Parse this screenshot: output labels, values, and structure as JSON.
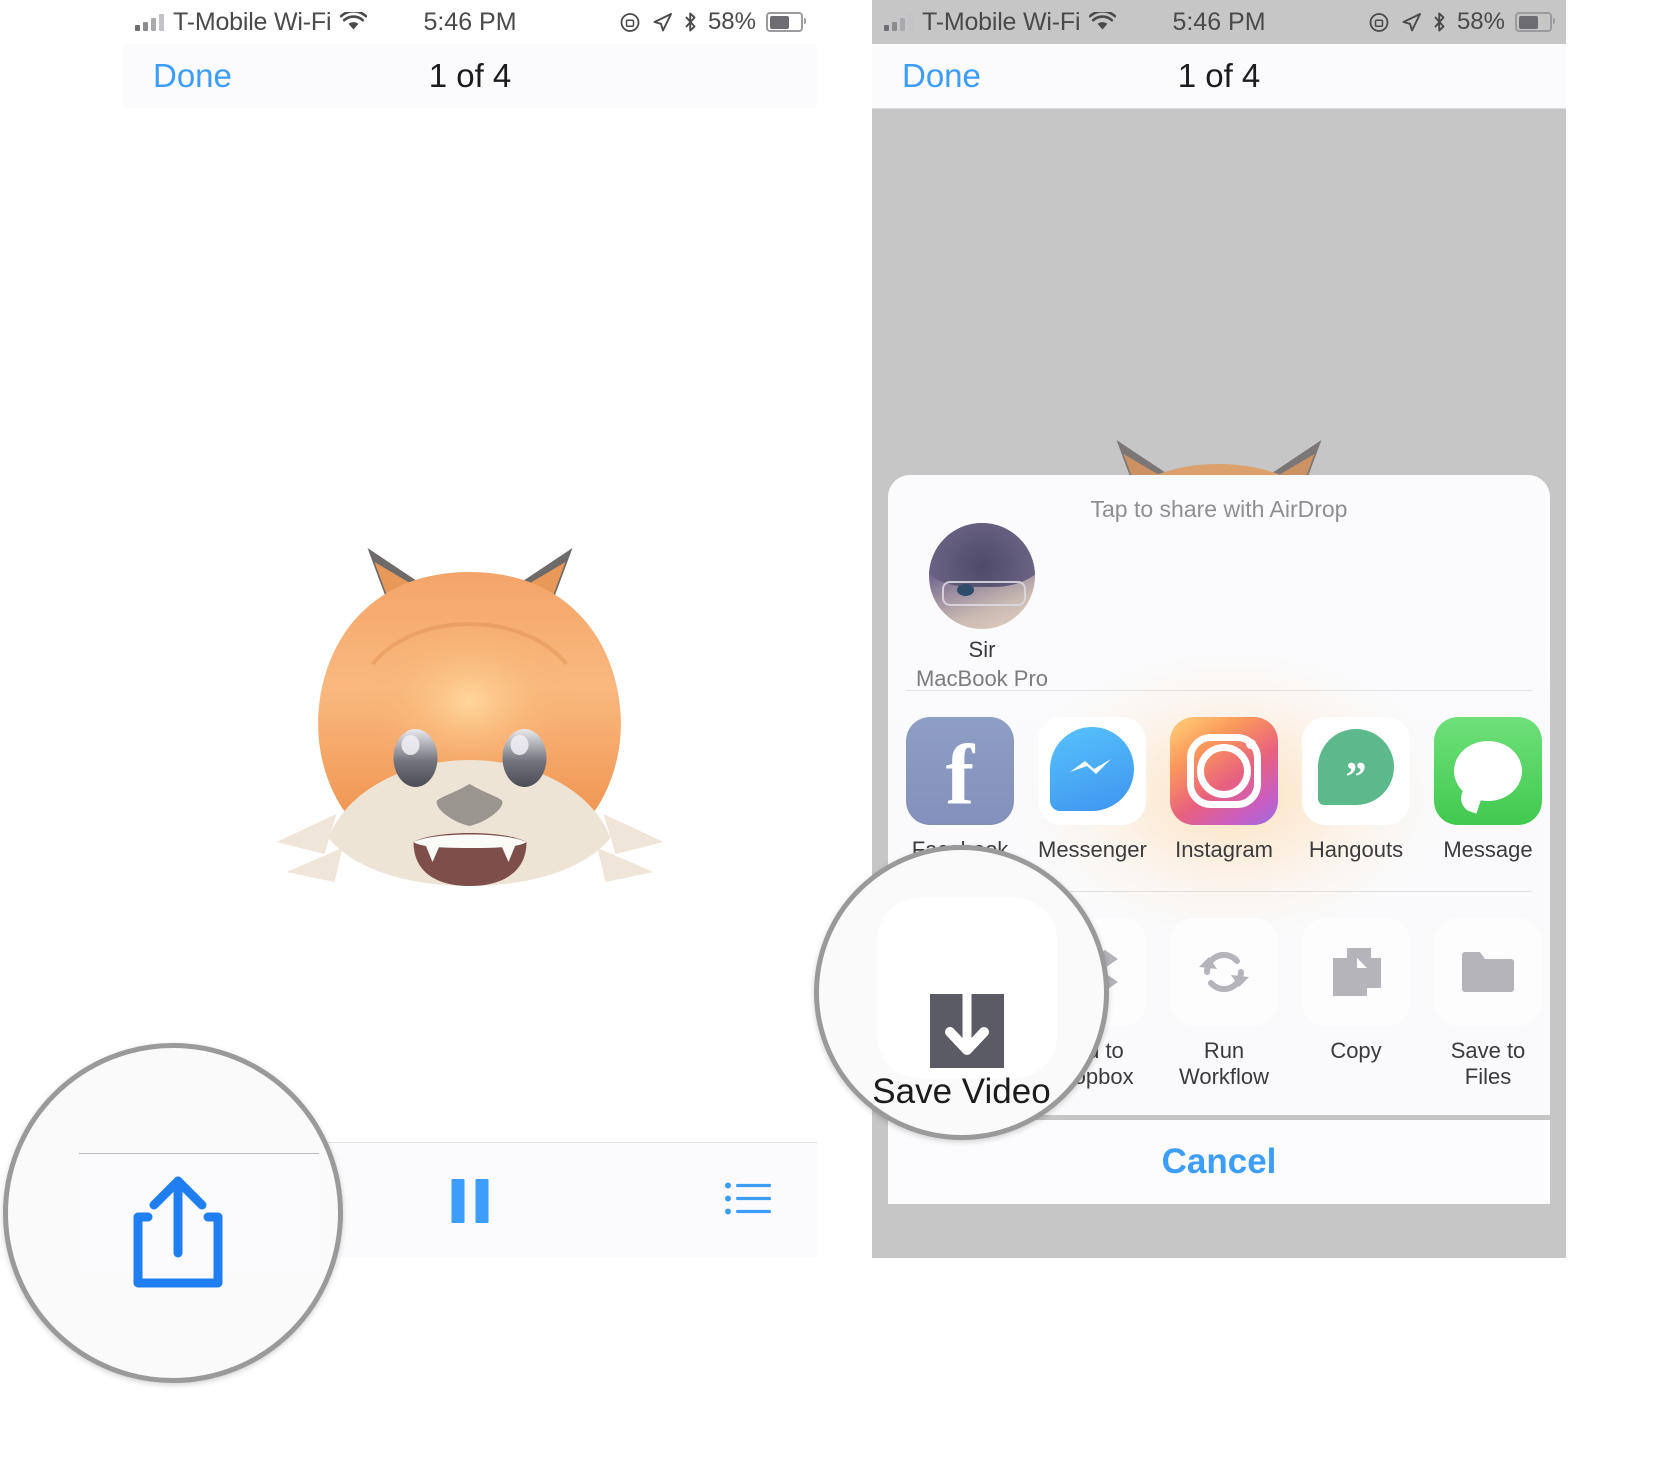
{
  "statusbar": {
    "carrier": "T-Mobile Wi-Fi",
    "time": "5:46 PM",
    "battery_percent": "58%",
    "icons": [
      "signal-bars-icon",
      "wifi-icon",
      "rotation-lock-icon",
      "location-arrow-icon",
      "bluetooth-icon",
      "battery-icon"
    ]
  },
  "navbar": {
    "done_label": "Done",
    "title": "1 of 4"
  },
  "left_screen": {
    "media": "animoji-fox-video",
    "toolbar": {
      "share_label": "share-icon",
      "playback_label": "pause-icon",
      "list_label": "list-icon"
    }
  },
  "share_sheet": {
    "airdrop_hint": "Tap to share with AirDrop",
    "airdrop_contacts": [
      {
        "name": "Sir",
        "device": "MacBook Pro"
      }
    ],
    "apps": [
      {
        "label": "Facebook",
        "icon": "facebook-icon"
      },
      {
        "label": "Messenger",
        "icon": "messenger-icon"
      },
      {
        "label": "Instagram",
        "icon": "instagram-icon"
      },
      {
        "label": "Hangouts",
        "icon": "hangouts-icon"
      },
      {
        "label": "Message",
        "icon": "message-icon"
      }
    ],
    "actions": [
      {
        "label": "Save Video",
        "icon": "save-video-icon"
      },
      {
        "label": "Add to Dropbox",
        "icon": "dropbox-icon"
      },
      {
        "label": "Run Workflow",
        "icon": "run-workflow-icon"
      },
      {
        "label": "Copy",
        "icon": "copy-icon"
      },
      {
        "label": "Save to Files",
        "icon": "save-to-files-icon"
      }
    ],
    "cancel_label": "Cancel"
  },
  "callouts": {
    "left": {
      "target": "share-button",
      "icon": "share-icon"
    },
    "right": {
      "target": "save-video-action",
      "label": "Save Video"
    }
  },
  "colors": {
    "accent_blue": "#3c9dfa",
    "dim_overlay": "#c6c6c6",
    "sheet_bg": "#fbfbfd",
    "callout_ring": "#9a9a9a"
  }
}
